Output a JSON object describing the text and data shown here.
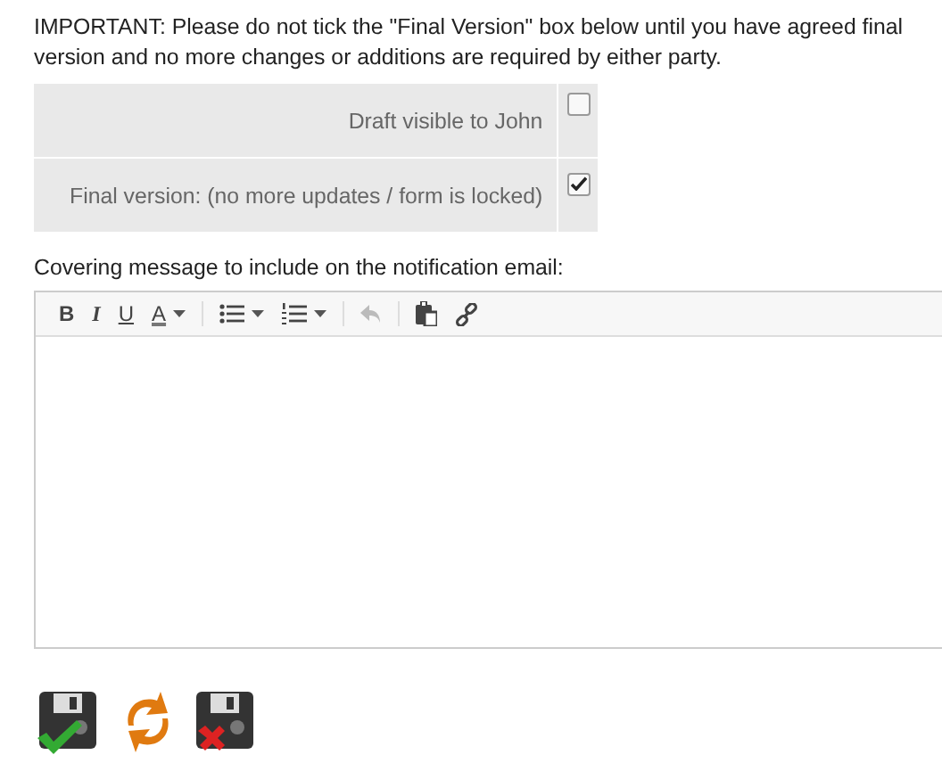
{
  "notice": "IMPORTANT: Please do not tick the \"Final Version\" box below until you have agreed final version and no more changes or additions are required by either party.",
  "options": [
    {
      "label": "Draft visible to John",
      "checked": false
    },
    {
      "label": "Final version: (no more updates / form is locked)",
      "checked": true
    }
  ],
  "message_label": "Covering message to include on the notification email:",
  "toolbar": [
    [
      {
        "kind": "bold",
        "label": "B",
        "dropdown": false,
        "disabled": false
      },
      {
        "kind": "italic",
        "label": "I",
        "dropdown": false,
        "disabled": false
      },
      {
        "kind": "underline",
        "label": "U",
        "dropdown": false,
        "disabled": false
      },
      {
        "kind": "color",
        "label": "A",
        "dropdown": true,
        "disabled": false
      }
    ],
    [
      {
        "kind": "bullets",
        "dropdown": true,
        "disabled": false
      },
      {
        "kind": "numbers",
        "dropdown": true,
        "disabled": false
      }
    ],
    [
      {
        "kind": "undo",
        "dropdown": false,
        "disabled": true
      }
    ],
    [
      {
        "kind": "paste",
        "dropdown": false,
        "disabled": false
      },
      {
        "kind": "link",
        "dropdown": false,
        "disabled": false
      }
    ]
  ],
  "actions": [
    {
      "kind": "save"
    },
    {
      "kind": "refresh"
    },
    {
      "kind": "discard"
    }
  ]
}
